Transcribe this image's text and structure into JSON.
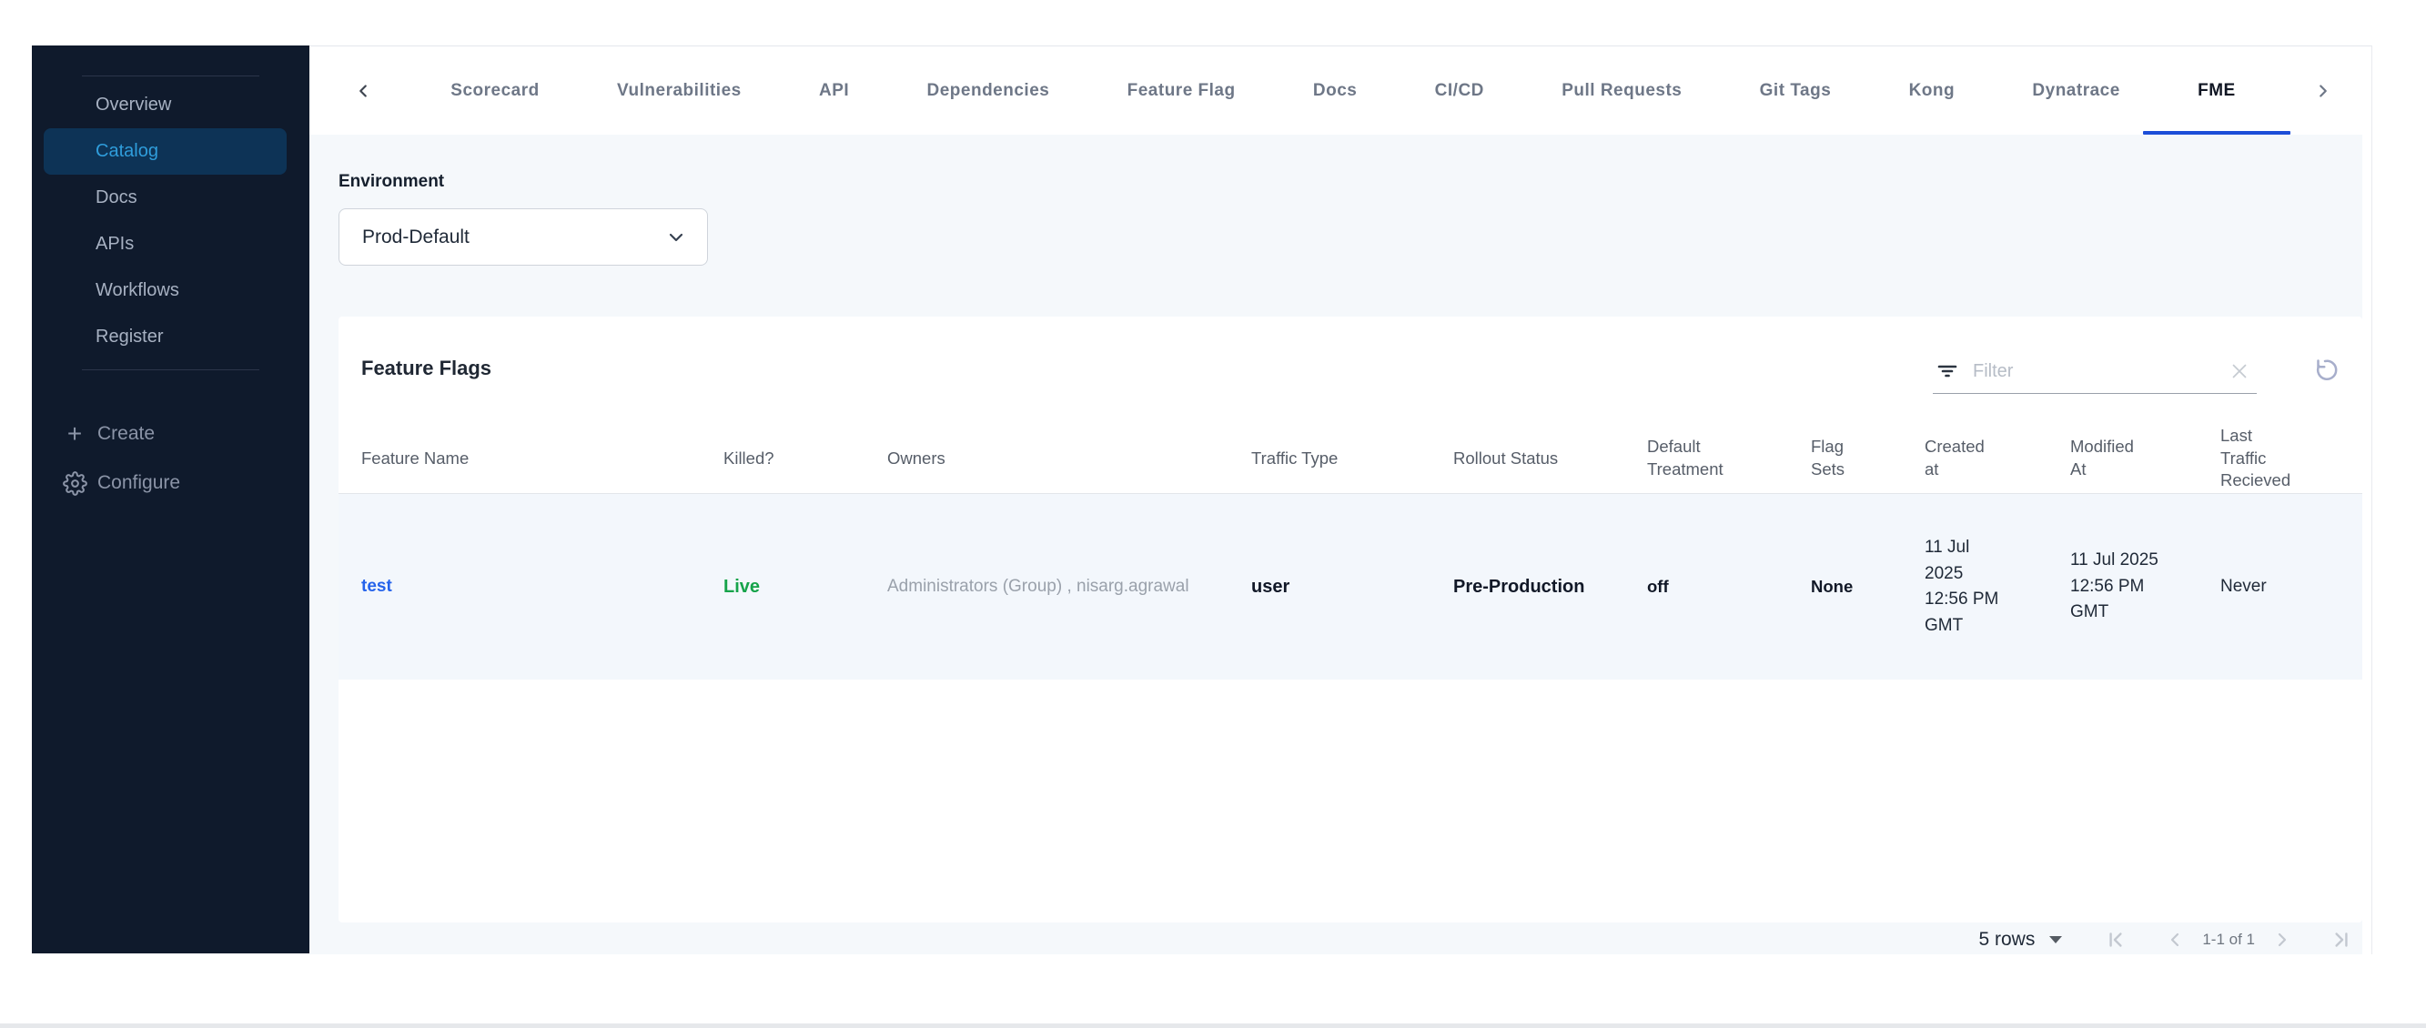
{
  "sidebar": {
    "items": [
      "Overview",
      "Catalog",
      "Docs",
      "APIs",
      "Workflows",
      "Register"
    ],
    "selected_item": "Catalog",
    "create_label": "Create",
    "configure_label": "Configure"
  },
  "tabs": {
    "items": [
      "Scorecard",
      "Vulnerabilities",
      "API",
      "Dependencies",
      "Feature Flag",
      "Docs",
      "CI/CD",
      "Pull Requests",
      "Git Tags",
      "Kong",
      "Dynatrace",
      "FME"
    ],
    "active": "FME"
  },
  "environment": {
    "label": "Environment",
    "selected_option": "Prod-Default"
  },
  "feature_flags_panel": {
    "title": "Feature Flags",
    "filter_placeholder": "Filter",
    "table": {
      "columns": [
        "Feature Name",
        "Killed?",
        "Owners",
        "Traffic Type",
        "Rollout Status",
        "Default\nTreatment",
        "Flag\nSets",
        "Created\nat",
        "Modified\nAt",
        "Last\nTraffic\nRecieved"
      ],
      "rows": [
        {
          "feature_name": "test",
          "killed": "Live",
          "owners": "Administrators (Group) , nisarg.agrawal",
          "traffic_type": "user",
          "rollout_status": "Pre-Production",
          "default_treatment": "off",
          "flag_sets": "None",
          "created_at": "11 Jul\n2025\n12:56 PM\nGMT",
          "modified_at": "11 Jul 2025\n12:56 PM\nGMT",
          "last_traffic_recieved": "Never"
        }
      ]
    }
  },
  "pagination": {
    "rows_per_page": "5 rows",
    "range": "1-1 of 1"
  },
  "colors": {
    "sidebar_bg": "#0f1a2c",
    "sidebar_selected_bg": "#0d3356",
    "sidebar_selected_text": "#2f9ddb",
    "active_tab_underline": "#1d4ed8",
    "link_blue": "#2563eb",
    "live_green": "#16a34a",
    "content_bg": "#f5f8fb",
    "row_bg": "#f3f7fc"
  }
}
